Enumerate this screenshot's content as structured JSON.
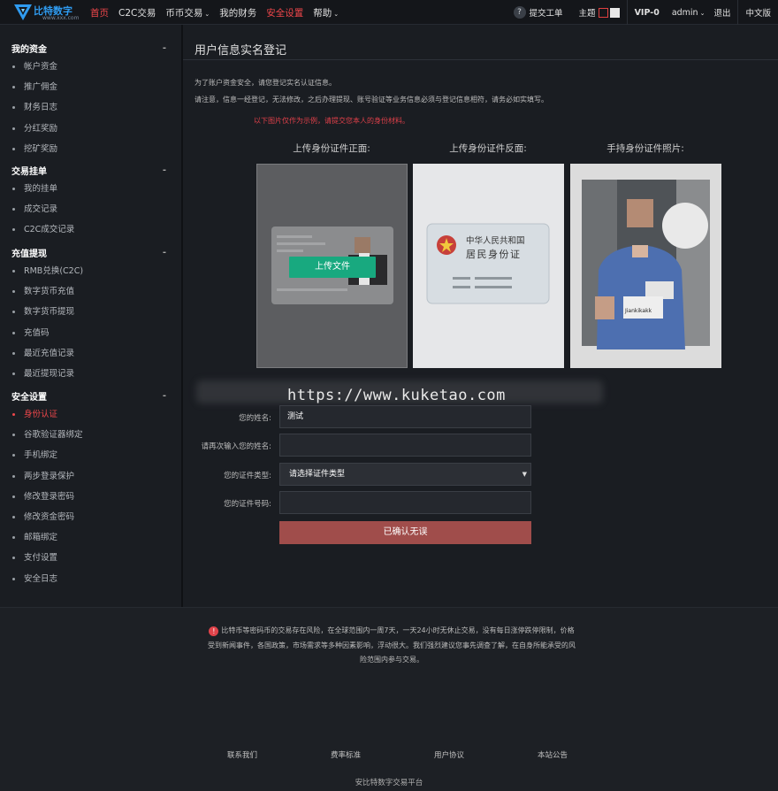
{
  "header": {
    "logo_text": "比特数字",
    "logo_sub": "www.xxx.com",
    "nav": [
      {
        "label": "首页",
        "active": true
      },
      {
        "label": "C2C交易"
      },
      {
        "label": "币币交易",
        "dropdown": true
      },
      {
        "label": "我的财务"
      },
      {
        "label": "安全设置",
        "red": true
      },
      {
        "label": "帮助",
        "dropdown": true
      }
    ],
    "ticket": "提交工单",
    "theme_label": "主题",
    "vip": "VIP-0",
    "user": "admin",
    "logout": "退出",
    "language": "中文版"
  },
  "sidebar": {
    "groups": [
      {
        "title": "我的资金",
        "items": [
          "帐户资金",
          "推广佣金",
          "财务日志",
          "分红奖励",
          "挖矿奖励"
        ]
      },
      {
        "title": "交易挂单",
        "items": [
          "我的挂单",
          "成交记录",
          "C2C成交记录"
        ]
      },
      {
        "title": "充值提现",
        "items": [
          "RMB兑换(C2C)",
          "数字货币充值",
          "数字货币提现",
          "充值码",
          "最近充值记录",
          "最近提现记录"
        ]
      },
      {
        "title": "安全设置",
        "items": [
          "身份认证",
          "谷歌验证器绑定",
          "手机绑定",
          "两步登录保护",
          "修改登录密码",
          "修改资金密码",
          "邮箱绑定",
          "支付设置",
          "安全日志"
        ],
        "active_index": 0
      }
    ]
  },
  "main": {
    "title": "用户信息实名登记",
    "notice1": "为了账户资金安全，请您登记实名认证信息。",
    "notice2": "请注意，信息一经登记，无法修改，之后办理提现、账号验证等业务信息必须与登记信息相符，请务必如实填写。",
    "sample_note": "以下图片仅作为示例，请提交您本人的身份材料。",
    "cards": [
      {
        "label": "上传身份证件正面:",
        "button": "上传文件"
      },
      {
        "label": "上传身份证件反面:",
        "id_title1": "中华人民共和国",
        "id_title2": "居民身份证"
      },
      {
        "label": "手持身份证件照片:",
        "photo_text": "Jiankikakk"
      }
    ],
    "watermark": "https://www.kuketao.com",
    "form": {
      "name_label": "您的姓名:",
      "name_value": "测试",
      "name2_label": "请再次输入您的姓名:",
      "name2_value": "",
      "idtype_label": "您的证件类型:",
      "idtype_value": "请选择证件类型",
      "idno_label": "您的证件号码:",
      "idno_value": "",
      "submit": "已确认无误"
    }
  },
  "footer": {
    "risk_text": "比特币等密码币的交易存在风险，在全球范围内一周7天，一天24小时无休止交易，没有每日涨停跌停限制，价格受到新闻事件，各国政策，市场需求等多种因素影响，浮动很大。我们强烈建议您事先调查了解，在自身所能承受的风险范围内参与交易。",
    "links": [
      "联系我们",
      "费率标准",
      "用户协议",
      "本站公告"
    ],
    "copyright": "安比特数字交易平台"
  }
}
